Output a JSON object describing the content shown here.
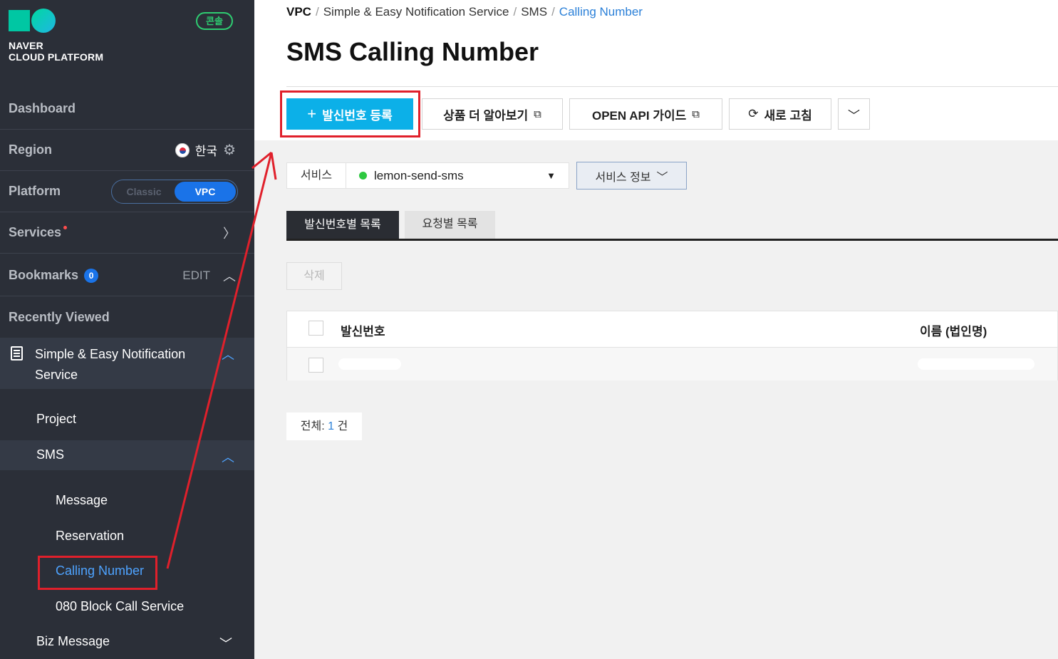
{
  "sidebar": {
    "logo_line1": "NAVER",
    "logo_line2": "CLOUD PLATFORM",
    "console_badge": "콘솔",
    "dashboard": "Dashboard",
    "region": {
      "label": "Region",
      "value": "한국"
    },
    "platform": {
      "label": "Platform",
      "classic": "Classic",
      "vpc": "VPC"
    },
    "services": "Services",
    "bookmarks": {
      "label": "Bookmarks",
      "count": "0",
      "edit": "EDIT"
    },
    "recently_viewed": "Recently Viewed",
    "sens": "Simple & Easy Notification Service",
    "items": {
      "project": "Project",
      "sms": "SMS",
      "message": "Message",
      "reservation": "Reservation",
      "calling_number": "Calling Number",
      "block_call": "080 Block Call Service",
      "biz_message": "Biz Message"
    }
  },
  "breadcrumb": {
    "vpc": "VPC",
    "sens": "Simple & Easy Notification Service",
    "sms": "SMS",
    "current": "Calling Number"
  },
  "page_title": "SMS Calling Number",
  "toolbar": {
    "register": "발신번호 등록",
    "learn_more": "상품 더 알아보기",
    "api_guide": "OPEN API 가이드",
    "refresh": "새로 고침"
  },
  "service": {
    "label": "서비스",
    "selected": "lemon-send-sms",
    "info_button": "서비스 정보"
  },
  "tabs": [
    "발신번호별 목록",
    "요청별 목록"
  ],
  "delete_button": "삭제",
  "table": {
    "columns": [
      "발신번호",
      "이름 (법인명)"
    ]
  },
  "total": {
    "label": "전체:",
    "count": "1",
    "unit": "건"
  },
  "colors": {
    "accent": "#0cb0e8",
    "highlight": "#e0202b",
    "link": "#2b80d8"
  }
}
